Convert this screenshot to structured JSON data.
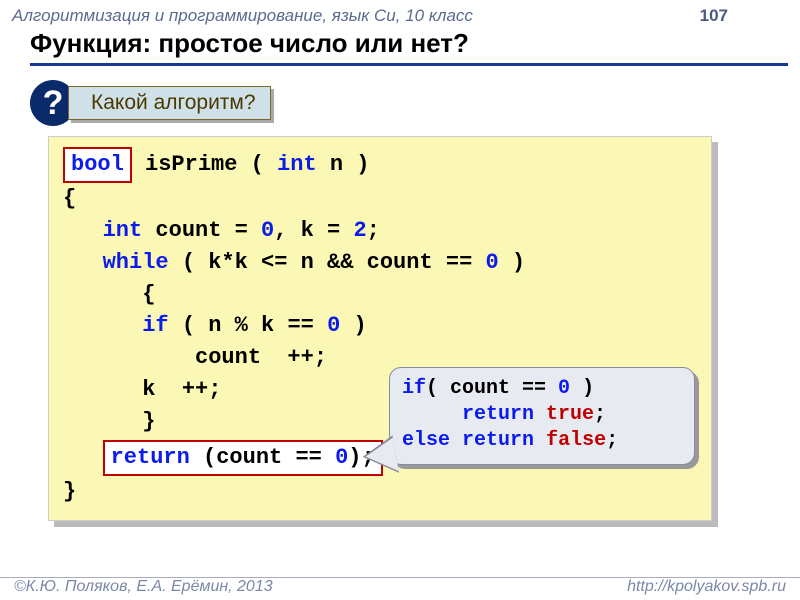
{
  "header": {
    "course": "Алгоритмизация и программирование, язык Си, 10 класс",
    "page_number": "107"
  },
  "title": "Функция: простое число или нет?",
  "question": {
    "mark": "?",
    "text": "Какой алгоритм?"
  },
  "code": {
    "line1_bool": "bool",
    "line1_rest_a": " isPrime ( ",
    "line1_int": "int",
    "line1_rest_b": " n )",
    "line2": "{",
    "line3_indent": "   ",
    "line3_int": "int",
    "line3_rest_a": " count = ",
    "line3_zero": "0",
    "line3_rest_b": ",  k = ",
    "line3_two": "2",
    "line3_rest_c": ";",
    "line4_indent": "   ",
    "line4_while": "while",
    "line4_rest_a": " ( k*k  <= n && count == ",
    "line4_zero": "0",
    "line4_rest_b": "  )",
    "line5": "      {",
    "line6_indent": "      ",
    "line6_if": "if",
    "line6_rest_a": " ( n % k == ",
    "line6_zero": "0",
    "line6_rest_b": " )",
    "line7": "          count  ++;",
    "line8": "      k  ++;",
    "line9": "      }",
    "line10_indent": "   ",
    "line10_return": "return",
    "line10_rest_a": " (count == ",
    "line10_zero": "0",
    "line10_rest_b": ");",
    "line11": "}"
  },
  "callout": {
    "l1_if": "if",
    "l1_rest_a": "( count == ",
    "l1_zero": "0",
    "l1_rest_b": "  )",
    "l2_return": "return",
    "l2_true": "true",
    "l2_semi": ";",
    "l3_else": "else",
    "l3_return": "return",
    "l3_false": "false",
    "l3_semi": ";"
  },
  "footer": {
    "left": "©К.Ю. Поляков, Е.А. Ерёмин, 2013",
    "right": "http://kpolyakov.spb.ru"
  }
}
